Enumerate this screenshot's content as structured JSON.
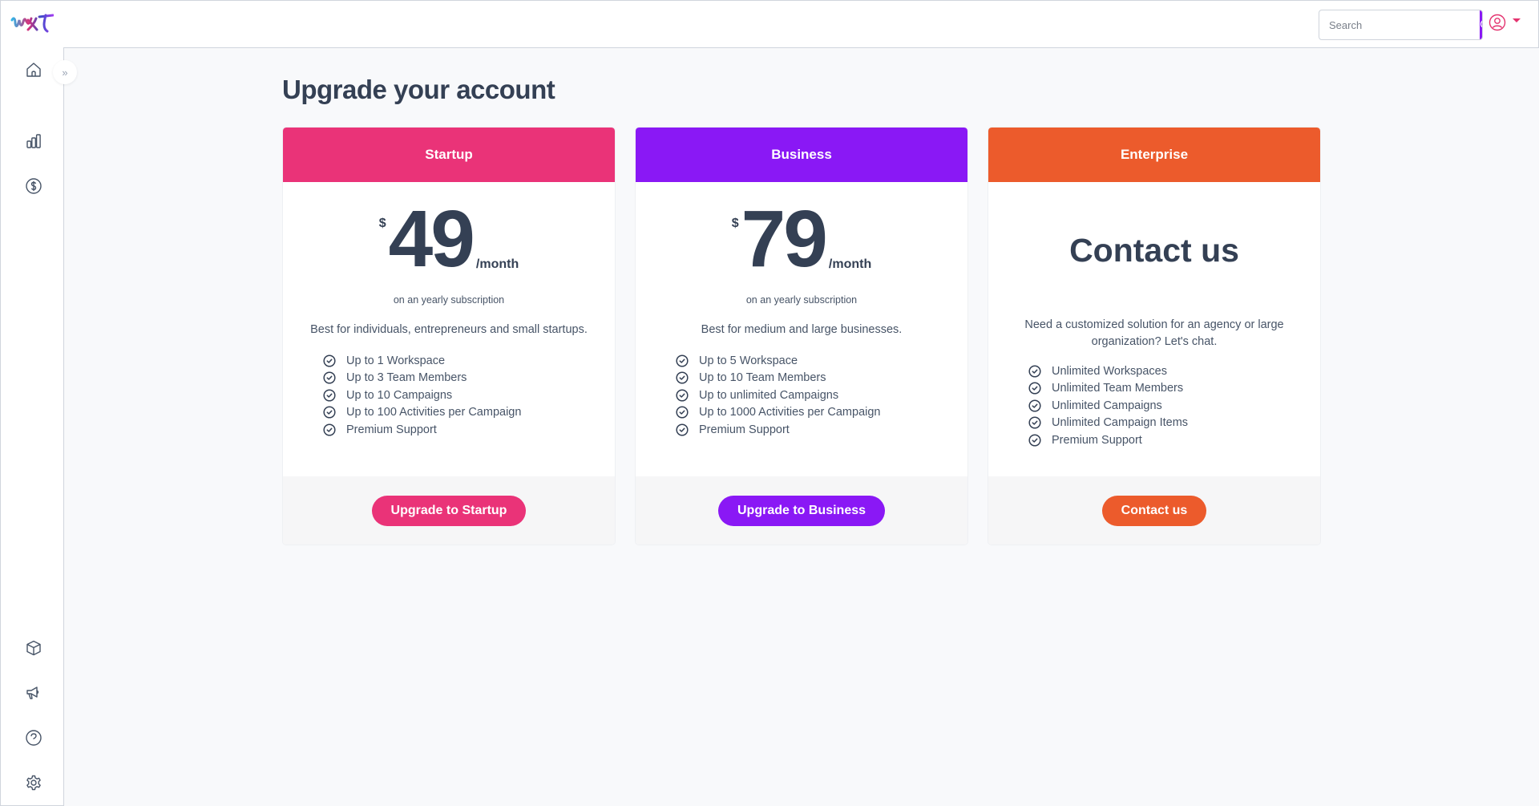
{
  "header": {
    "logo_text": "wxt",
    "search": {
      "placeholder": "Search",
      "value": ""
    },
    "icons": {
      "search": "search-icon",
      "user": "user-circle-icon",
      "caret": "caret-down-icon"
    }
  },
  "sidebar": {
    "expand_label": "»",
    "items": [
      {
        "name": "home",
        "icon": "home-icon"
      },
      {
        "name": "analytics",
        "icon": "bar-chart-icon"
      },
      {
        "name": "billing",
        "icon": "dollar-circle-icon"
      },
      {
        "name": "products",
        "icon": "cube-icon"
      },
      {
        "name": "campaigns",
        "icon": "megaphone-icon"
      },
      {
        "name": "help",
        "icon": "help-circle-icon"
      },
      {
        "name": "settings",
        "icon": "gear-icon"
      }
    ]
  },
  "page": {
    "title": "Upgrade your account"
  },
  "plans": [
    {
      "name": "Startup",
      "color": "#ea3378",
      "currency": "$",
      "price": "49",
      "period": "/month",
      "billing_note": "on an yearly subscription",
      "description": "Best for individuals, entrepreneurs and small startups.",
      "features": [
        "Up to 1 Workspace",
        "Up to 3 Team Members",
        "Up to 10 Campaigns",
        "Up to 100 Activities per Campaign",
        "Premium Support"
      ],
      "cta": "Upgrade to Startup"
    },
    {
      "name": "Business",
      "color": "#8a18f5",
      "currency": "$",
      "price": "79",
      "period": "/month",
      "billing_note": "on an yearly subscription",
      "description": "Best for medium and large businesses.",
      "features": [
        "Up to 5 Workspace",
        "Up to 10 Team Members",
        "Up to unlimited Campaigns",
        "Up to 1000 Activities per Campaign",
        "Premium Support"
      ],
      "cta": "Upgrade to Business"
    },
    {
      "name": "Enterprise",
      "color": "#ec5b2c",
      "headline": "Contact us",
      "description": "Need a customized solution for an agency or large organization? Let's chat.",
      "features": [
        "Unlimited Workspaces",
        "Unlimited Team Members",
        "Unlimited Campaigns",
        "Unlimited Campaign Items",
        "Premium Support"
      ],
      "cta": "Contact us"
    }
  ]
}
